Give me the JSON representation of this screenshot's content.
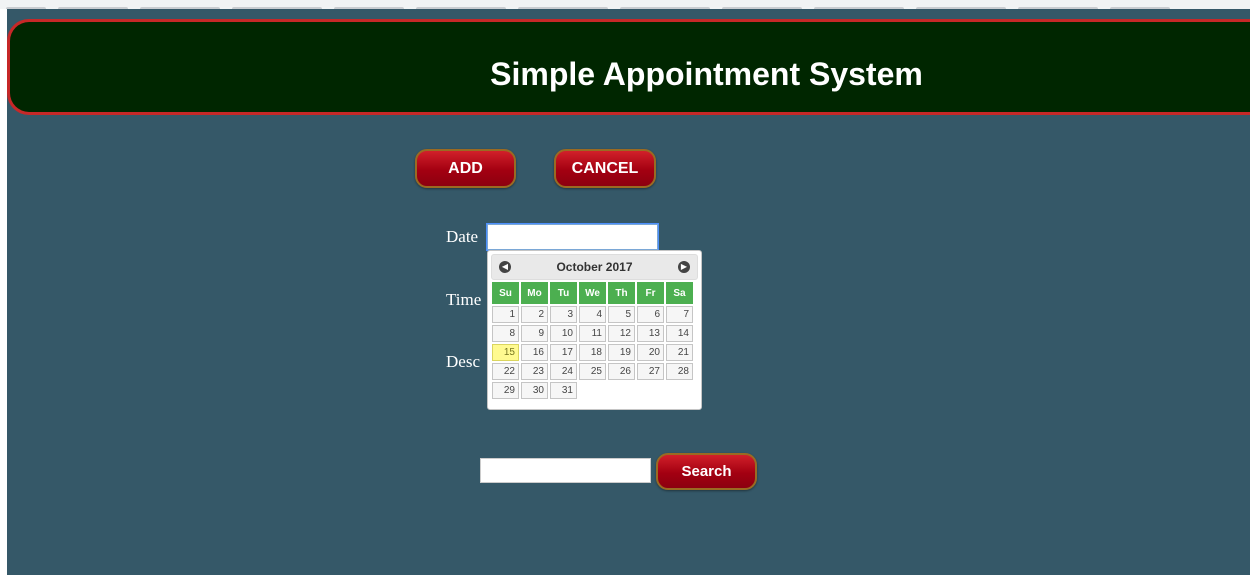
{
  "header": {
    "title": "Simple Appointment System"
  },
  "actions": {
    "add_label": "ADD",
    "cancel_label": "CANCEL"
  },
  "form": {
    "date_label": "Date",
    "time_label": "Time",
    "desc_label": "Desc",
    "date_value": ""
  },
  "datepicker": {
    "month_title": "October 2017",
    "prev_icon": "prev-month-icon",
    "next_icon": "next-month-icon",
    "weekdays": [
      "Su",
      "Mo",
      "Tu",
      "We",
      "Th",
      "Fr",
      "Sa"
    ],
    "weeks": [
      [
        "1",
        "2",
        "3",
        "4",
        "5",
        "6",
        "7"
      ],
      [
        "8",
        "9",
        "10",
        "11",
        "12",
        "13",
        "14"
      ],
      [
        "15",
        "16",
        "17",
        "18",
        "19",
        "20",
        "21"
      ],
      [
        "22",
        "23",
        "24",
        "25",
        "26",
        "27",
        "28"
      ],
      [
        "29",
        "30",
        "31",
        "",
        "",
        "",
        ""
      ]
    ],
    "highlighted_day": "15",
    "header_color": "#4caf50",
    "highlight_color": "#fffa90"
  },
  "search": {
    "value": "",
    "button_label": "Search"
  },
  "colors": {
    "page_bg": "#355868",
    "header_bg": "#002600",
    "header_border": "#c62828",
    "button_red": "#a30011"
  }
}
